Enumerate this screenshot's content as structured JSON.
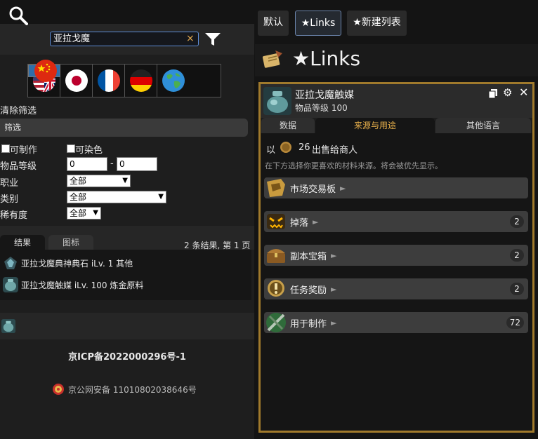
{
  "search": {
    "value": "亚拉戈魔",
    "clear": "×"
  },
  "languages": [
    {
      "name": "zh",
      "icon": "china-flag-icon"
    },
    {
      "name": "en",
      "icon": "uk-us-flag-icon"
    },
    {
      "name": "ja",
      "icon": "japan-flag-icon"
    },
    {
      "name": "fr",
      "icon": "france-flag-icon"
    },
    {
      "name": "de",
      "icon": "germany-flag-icon"
    },
    {
      "name": "global",
      "icon": "globe-icon"
    }
  ],
  "filters": {
    "clear_label": "清除筛选",
    "section_label": "筛选",
    "craftable_label": "可制作",
    "dyeable_label": "可染色",
    "item_level_label": "物品等级",
    "item_level_min": "0",
    "item_level_sep": "-",
    "item_level_max": "0",
    "job_label": "职业",
    "job_value": "全部",
    "category_label": "类别",
    "category_value": "全部",
    "rarity_label": "稀有度",
    "rarity_value": "全部"
  },
  "results": {
    "tab_results": "结果",
    "tab_icons": "图标",
    "summary": "2 条结果, 第 1 页",
    "items": [
      {
        "name": "亚拉戈魔典神典石",
        "meta": "iLv. 1 其他"
      },
      {
        "name": "亚拉戈魔触媒",
        "meta": "iLv. 100 炼金原料"
      }
    ]
  },
  "footer": {
    "icp": "京ICP备2022000296号-1",
    "police": "京公网安备 11010802038646号"
  },
  "right_tabs": [
    "默认",
    "★Links",
    "★新建列表"
  ],
  "links_title": "★Links",
  "item": {
    "name": "亚拉戈魔触媒",
    "level_text": "物品等级 100",
    "tabs": [
      "数据",
      "来源与用途",
      "其他语言"
    ],
    "sell_prefix": "以",
    "sell_price": "26",
    "sell_suffix": "出售给商人",
    "hint": "在下方选择你更喜欢的材料来源。将会被优先显示。",
    "sources": [
      {
        "label": "市场交易板",
        "count": "",
        "icon": "market-board-icon"
      },
      {
        "label": "掉落",
        "count": "2",
        "icon": "monster-drop-icon"
      },
      {
        "label": "副本宝箱",
        "count": "2",
        "icon": "treasure-chest-icon"
      },
      {
        "label": "任务奖励",
        "count": "2",
        "icon": "quest-reward-icon"
      },
      {
        "label": "用于制作",
        "count": "72",
        "icon": "crafting-icon"
      }
    ]
  },
  "colors": {
    "accent_gold": "#a07a2c",
    "active_tab": "#2f6ea8",
    "search_border": "#5e8dd6"
  }
}
